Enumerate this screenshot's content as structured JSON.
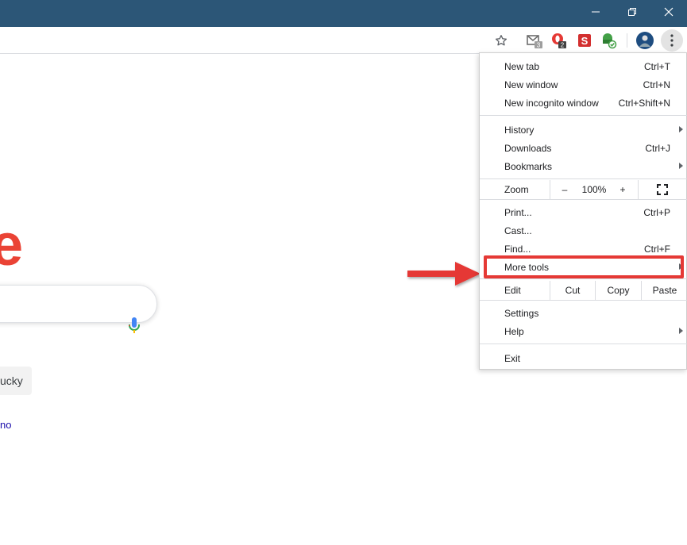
{
  "window_controls": {
    "minimize_icon": "minimize-icon",
    "restore_icon": "restore-icon",
    "close_icon": "close-icon"
  },
  "toolbar": {
    "icons": [
      "star-icon",
      "gmail-extension-icon",
      "opera-extension-icon",
      "s-extension-icon",
      "green-extension-icon",
      "avatar",
      "vertical-dots-icon"
    ],
    "gmail_badge": "3",
    "opera_badge": "2",
    "s_label": "S"
  },
  "page": {
    "logo_fragment": "e",
    "lucky_button_fragment": "ucky",
    "link_fragment": "no"
  },
  "menu": {
    "items": [
      {
        "label": "New tab",
        "shortcut": "Ctrl+T"
      },
      {
        "label": "New window",
        "shortcut": "Ctrl+N"
      },
      {
        "label": "New incognito window",
        "shortcut": "Ctrl+Shift+N"
      },
      {
        "label": "History",
        "shortcut": ""
      },
      {
        "label": "Downloads",
        "shortcut": "Ctrl+J"
      },
      {
        "label": "Bookmarks",
        "shortcut": ""
      },
      {
        "label": "Print...",
        "shortcut": "Ctrl+P"
      },
      {
        "label": "Cast...",
        "shortcut": ""
      },
      {
        "label": "Find...",
        "shortcut": "Ctrl+F"
      },
      {
        "label": "More tools",
        "shortcut": ""
      },
      {
        "label": "Settings",
        "shortcut": ""
      },
      {
        "label": "Help",
        "shortcut": ""
      },
      {
        "label": "Exit",
        "shortcut": ""
      }
    ],
    "zoom": {
      "label": "Zoom",
      "minus": "–",
      "value": "100%",
      "plus": "+"
    },
    "edit": {
      "label": "Edit",
      "cut": "Cut",
      "copy": "Copy",
      "paste": "Paste"
    }
  },
  "colors": {
    "titlebar": "#2c5677",
    "highlight": "#e53935",
    "google_red": "#ea4335"
  }
}
